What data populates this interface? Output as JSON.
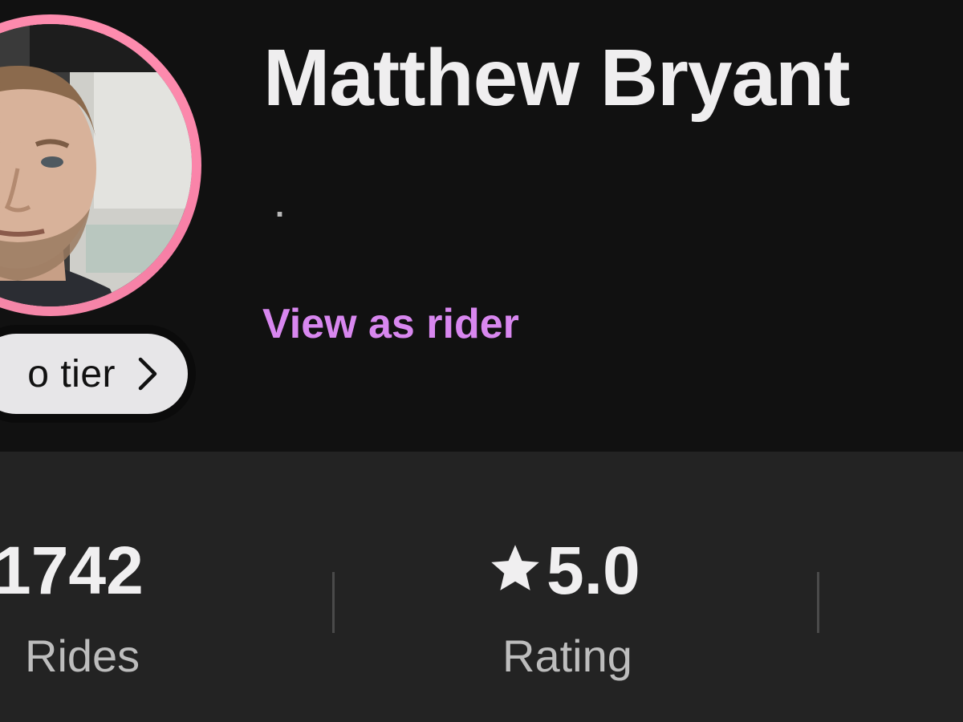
{
  "profile": {
    "name": "Matthew Bryant",
    "subtitle": ".",
    "view_as_rider_label": "View as rider",
    "tier_label": "o tier"
  },
  "stats": {
    "rides": {
      "value": "1742",
      "label": "Rides"
    },
    "rating": {
      "value": "5.0",
      "label": "Rating"
    }
  },
  "icons": {
    "rating_icon": "star-icon",
    "tier_icon": "chevron-right-icon"
  },
  "colors": {
    "background": "#111111",
    "stats_background": "#232323",
    "accent": "#d887ef",
    "avatar_ring": "#f77fa6",
    "text_primary": "#efeeef",
    "text_secondary": "#bdbdbd"
  }
}
